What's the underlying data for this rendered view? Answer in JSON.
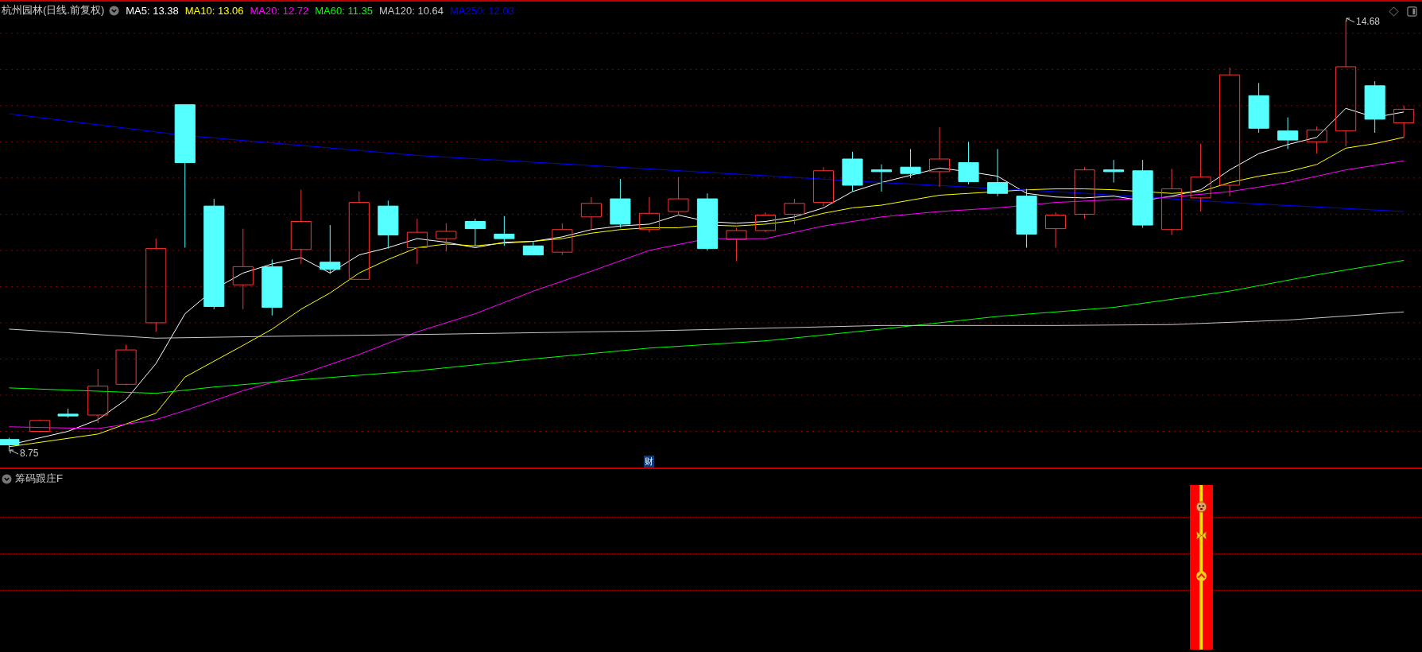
{
  "chart_header": {
    "title": "杭州园林(日线.前复权)",
    "moving_averages": [
      {
        "label": "MA5: 13.38",
        "color": "#ffffff"
      },
      {
        "label": "MA10: 13.06",
        "color": "#ffff00"
      },
      {
        "label": "MA20: 12.72",
        "color": "#ff00ff"
      },
      {
        "label": "MA60: 11.35",
        "color": "#00ff00"
      },
      {
        "label": "MA120: 10.64",
        "color": "#c8c8c8"
      },
      {
        "label": "MA250: 12.03",
        "color": "#0000ff"
      }
    ]
  },
  "price_chart": {
    "high_marker": "14.68",
    "low_marker": "8.75",
    "finance_badge": "财"
  },
  "indicator_panel": {
    "title": "筹码跟庄F"
  }
}
